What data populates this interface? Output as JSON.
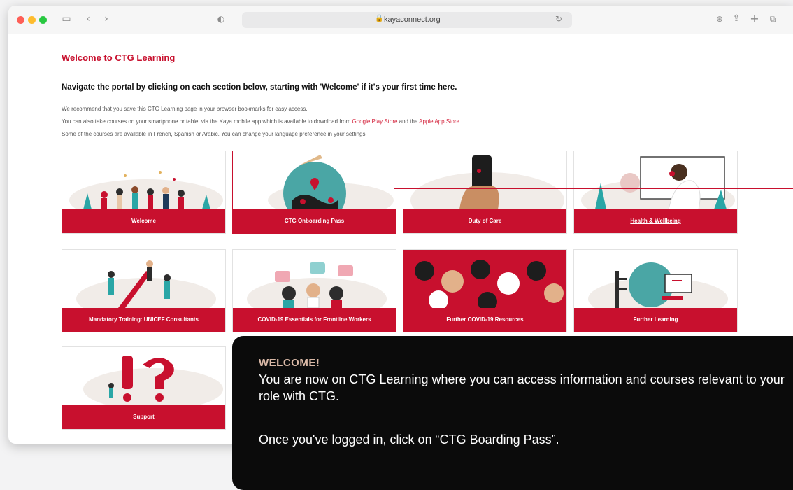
{
  "browser": {
    "url": "kayaconnect.org",
    "traffic_lights": [
      "#fe5f57",
      "#febc2e",
      "#28c840"
    ]
  },
  "page": {
    "title": "Welcome to CTG Learning",
    "nav_heading": "Navigate the portal by clicking on each section below, starting with 'Welcome' if it's your first time here.",
    "info_line1": "We recommend that you save this CTG Learning page in your browser bookmarks for easy access.",
    "info_line2_prefix": "You can also take courses on your smartphone or tablet via the Kaya mobile app which is available to download from ",
    "info_link_google": "Google Play Store",
    "info_line2_mid": " and the ",
    "info_link_apple": "Apple App Store",
    "info_line2_suffix": ".",
    "info_line3": "Some of the courses are available in French, Spanish or Arabic. You can change your language preference in your settings."
  },
  "tiles": [
    {
      "label": "Welcome"
    },
    {
      "label": "CTG Onboarding Pass"
    },
    {
      "label": "Duty of Care"
    },
    {
      "label": "Health & Wellbeing"
    },
    {
      "label": "Mandatory Training: UNICEF Consultants"
    },
    {
      "label": "COVID-19 Essentials for Frontline Workers"
    },
    {
      "label": "Further COVID-19 Resources"
    },
    {
      "label": "Further Learning"
    },
    {
      "label": "Support"
    }
  ],
  "callout": {
    "title": "WELCOME!",
    "body": "You are now on CTG Learning where you can access information and courses relevant to your role with CTG.",
    "body2": "Once you've logged in, click on “CTG Boarding Pass”."
  },
  "colors": {
    "brand_red": "#c8102e",
    "callout_bg": "#0b0b0b",
    "callout_title": "#d9b8a6"
  }
}
